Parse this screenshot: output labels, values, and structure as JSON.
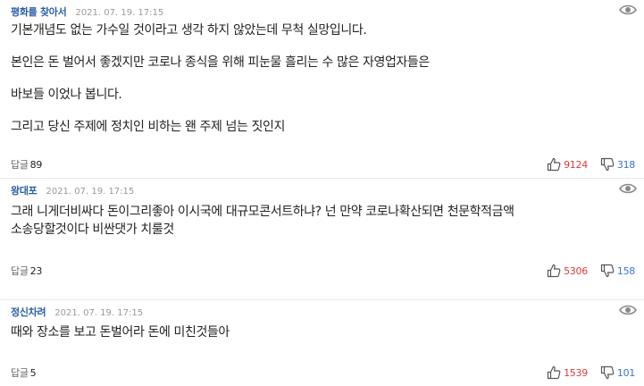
{
  "comments": [
    {
      "author": "평화를 찾아서",
      "date": "2021. 07. 19. 17:15",
      "paragraphs": [
        "기본개념도 없는 가수일 것이라고 생각 하지 않았는데 무척 실망입니다.",
        "본인은 돈 벌어서 좋겠지만 코로나 종식을 위해 피눈물 흘리는 수 많은 자영업자들은",
        "바보들 이었나 봅니다.",
        "그리고 당신 주제에 정치인 비하는 왠 주제 넘는 짓인지"
      ],
      "reply_label": "답글",
      "reply_count": "89",
      "likes": "9124",
      "dislikes": "318"
    },
    {
      "author": "왕대포",
      "date": "2021. 07. 19. 17:15",
      "paragraphs": [
        "그래 니게더비싸다  돈이그리좋아  이시국에 대규모콘서트하냐?  넌  만약 코로나확산되면 천문학적금액",
        "소송당할것이다  비싼댓가 치룰것"
      ],
      "reply_label": "답글",
      "reply_count": "23",
      "likes": "5306",
      "dislikes": "158"
    },
    {
      "author": "정신차려",
      "date": "2021. 07. 19. 17:15",
      "paragraphs": [
        "때와 장소를 보고 돈벌어라 돈에 미친것들아"
      ],
      "reply_label": "답글",
      "reply_count": "5",
      "likes": "1539",
      "dislikes": "101"
    }
  ],
  "icons": {
    "view": "eye-icon",
    "like": "thumbs-up-icon",
    "dislike": "thumbs-down-icon"
  },
  "colors": {
    "author": "#2b5fa6",
    "like_count": "#e03a3a",
    "dislike_count": "#3a72d8"
  }
}
